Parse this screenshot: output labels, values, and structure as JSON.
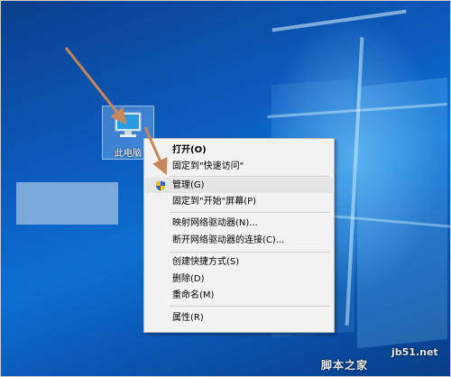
{
  "desktop": {
    "icon_label": "此电脑",
    "accent_color": "#0c5bbd"
  },
  "context_menu": {
    "items": [
      {
        "label": "打开(O)",
        "bold": true
      },
      {
        "label": "固定到\"快速访问\""
      },
      {
        "label": "管理(G)",
        "icon": "uac-shield-icon",
        "highlighted": true
      },
      {
        "label": "固定到\"开始\"屏幕(P)"
      },
      {
        "label": "映射网络驱动器(N)..."
      },
      {
        "label": "断开网络驱动器的连接(C)..."
      },
      {
        "label": "创建快捷方式(S)"
      },
      {
        "label": "删除(D)"
      },
      {
        "label": "重命名(M)"
      },
      {
        "label": "属性(R)"
      }
    ]
  },
  "watermark": {
    "site": "jb51.net",
    "name": "脚本之家"
  },
  "arrow_color": "#c8875a"
}
